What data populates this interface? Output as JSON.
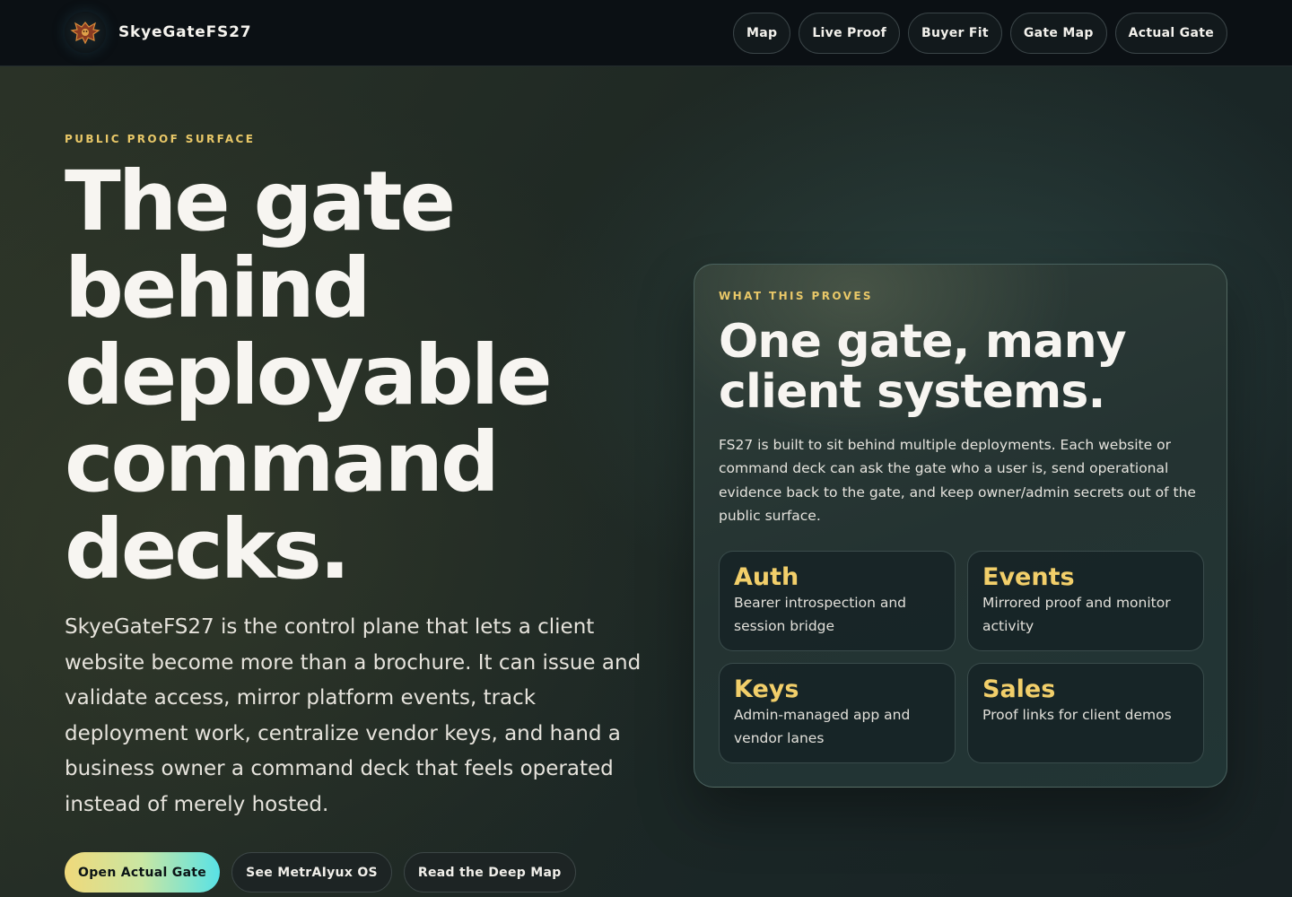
{
  "header": {
    "brand_name": "SkyeGateFS27",
    "nav": [
      {
        "label": "Map"
      },
      {
        "label": "Live Proof"
      },
      {
        "label": "Buyer Fit"
      },
      {
        "label": "Gate Map"
      },
      {
        "label": "Actual Gate"
      }
    ]
  },
  "hero": {
    "eyebrow": "PUBLIC PROOF SURFACE",
    "headline_lines": [
      "The gate",
      "behind",
      "deployable",
      "command",
      "decks."
    ],
    "lede": "SkyeGateFS27 is the control plane that lets a client website become more than a brochure. It can issue and validate access, mirror platform events, track deployment work, centralize vendor keys, and hand a business owner a command deck that feels operated instead of merely hosted.",
    "cta_primary": "Open Actual Gate",
    "cta_secondary_1": "See MetrAIyux OS",
    "cta_secondary_2": "Read the Deep Map"
  },
  "card": {
    "eyebrow": "WHAT THIS PROVES",
    "title_lines": [
      "One gate, many",
      "client systems."
    ],
    "body": "FS27 is built to sit behind multiple deployments. Each website or command deck can ask the gate who a user is, send operational evidence back to the gate, and keep owner/admin secrets out of the public surface.",
    "tiles": [
      {
        "title": "Auth",
        "desc": "Bearer introspection and session bridge"
      },
      {
        "title": "Events",
        "desc": "Mirrored proof and monitor activity"
      },
      {
        "title": "Keys",
        "desc": "Admin-managed app and vendor lanes"
      },
      {
        "title": "Sales",
        "desc": "Proof links for client demos"
      }
    ]
  },
  "colors": {
    "accent_gold": "#e9c868",
    "cta_gradient_start": "#f0d97a",
    "cta_gradient_end": "#58e2e6",
    "topbar_bg": "#0b1014"
  },
  "icons": {
    "brand_logo": "dragon-crest-icon"
  }
}
